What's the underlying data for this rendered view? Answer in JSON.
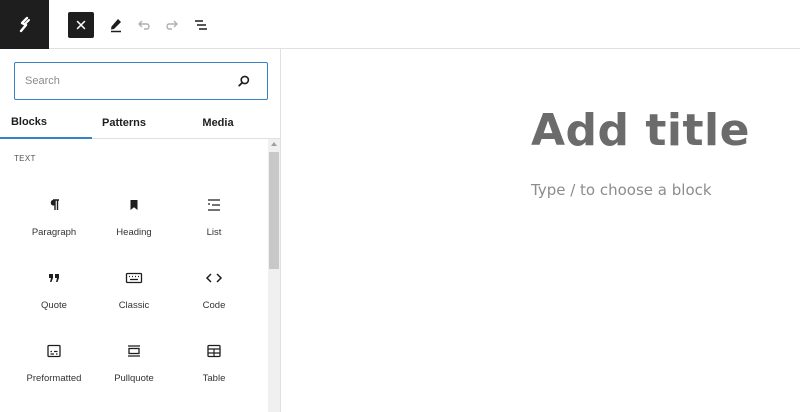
{
  "toolbar": {
    "logo_icon": "site-logo-icon",
    "close_icon": "close-icon",
    "tools": [
      "pencil-icon",
      "undo-icon",
      "redo-icon",
      "list-view-icon"
    ]
  },
  "inserter": {
    "search": {
      "placeholder": "Search",
      "value": ""
    },
    "tabs": [
      {
        "label": "Blocks",
        "active": true
      },
      {
        "label": "Patterns",
        "active": false
      },
      {
        "label": "Media",
        "active": false
      }
    ],
    "section_title": "TEXT",
    "blocks": [
      {
        "label": "Paragraph",
        "icon": "paragraph-icon"
      },
      {
        "label": "Heading",
        "icon": "heading-icon"
      },
      {
        "label": "List",
        "icon": "list-icon"
      },
      {
        "label": "Quote",
        "icon": "quote-icon"
      },
      {
        "label": "Classic",
        "icon": "classic-icon"
      },
      {
        "label": "Code",
        "icon": "code-icon"
      },
      {
        "label": "Preformatted",
        "icon": "preformatted-icon"
      },
      {
        "label": "Pullquote",
        "icon": "pullquote-icon"
      },
      {
        "label": "Table",
        "icon": "table-icon"
      }
    ]
  },
  "editor": {
    "title_placeholder": "Add title",
    "block_hint": "Type / to choose a block"
  },
  "colors": {
    "accent": "#3582c4",
    "dark": "#1e1e1e",
    "title_gray": "#6b6b6b"
  }
}
